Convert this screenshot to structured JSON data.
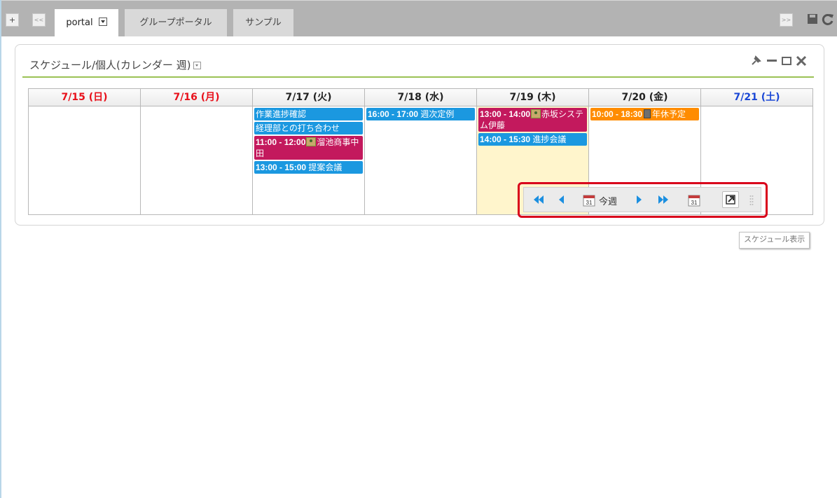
{
  "tabbar": {
    "add_label": "+",
    "prev_label": "<<",
    "next_label": ">>",
    "tabs": [
      {
        "label": "portal"
      },
      {
        "label": "グループポータル"
      },
      {
        "label": "サンプル"
      }
    ]
  },
  "portlet": {
    "title": "スケジュール/個人(カレンダー 週)",
    "accent_color": "#9bc255"
  },
  "calendar": {
    "days": [
      {
        "label": "7/15 (日)",
        "color": "#e8101a",
        "events": []
      },
      {
        "label": "7/16 (月)",
        "color": "#e8101a",
        "events": []
      },
      {
        "label": "7/17 (火)",
        "color": "#222222",
        "events": [
          {
            "time": "",
            "text": "作業進捗確認",
            "color": "blue",
            "icon": ""
          },
          {
            "time": "",
            "text": "経理部との打ち合わせ",
            "color": "blue",
            "icon": ""
          },
          {
            "time": "11:00 - 12:00",
            "text": "溜池商事中田",
            "color": "magenta",
            "icon": "person-icon"
          },
          {
            "time": "13:00 - 15:00",
            "text": "提案会議",
            "color": "blue",
            "icon": ""
          }
        ]
      },
      {
        "label": "7/18 (水)",
        "color": "#222222",
        "events": [
          {
            "time": "16:00 - 17:00",
            "text": "週次定例",
            "color": "blue",
            "icon": ""
          }
        ]
      },
      {
        "label": "7/19 (木)",
        "color": "#222222",
        "today": true,
        "events": [
          {
            "time": "13:00 - 14:00",
            "text": "赤坂システム伊藤",
            "color": "magenta",
            "icon": "person-icon"
          },
          {
            "time": "14:00 - 15:30",
            "text": "進捗会議",
            "color": "blue",
            "icon": ""
          }
        ]
      },
      {
        "label": "7/20 (金)",
        "color": "#222222",
        "events": [
          {
            "time": "10:00 - 18:30",
            "text": "年休予定",
            "color": "orange",
            "icon": "document-icon"
          }
        ]
      },
      {
        "label": "7/21 (土)",
        "color": "#1a47d6",
        "events": []
      }
    ]
  },
  "navigation": {
    "today_label": "今週",
    "calendar_icon_text": "31",
    "highlight_color": "#d9001b"
  },
  "tooltip": {
    "text": "スケジュール表示"
  }
}
